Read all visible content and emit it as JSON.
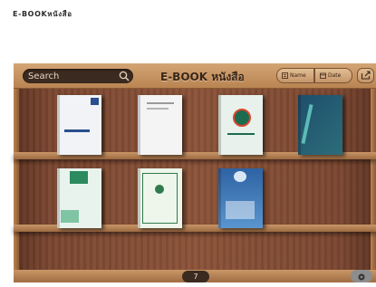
{
  "page": {
    "heading": "E-BOOKหนังสือ"
  },
  "toolbar": {
    "search_placeholder": "Search",
    "title": "E-BOOK หนังสือ",
    "sort_name_label": "Name",
    "sort_date_label": "Date"
  },
  "shelves": [
    {
      "books": [
        {
          "cover_color": "#f1f3f6",
          "accent_color": "#2a4f8f"
        },
        {
          "cover_color": "#f4f4f4",
          "accent_color": "#9a9a9a"
        },
        {
          "cover_color": "#e8f1ec",
          "accent_color": "#1c6b4f"
        },
        {
          "cover_color": "#1e4e6c",
          "accent_color": "#5dbbb7"
        }
      ]
    },
    {
      "books": [
        {
          "cover_color": "#e8f3ee",
          "accent_color": "#2b8a5e"
        },
        {
          "cover_color": "#eef5ea",
          "accent_color": "#2f7a4d"
        },
        {
          "cover_color": "#3c79b8",
          "accent_color": "#d8e6f4"
        }
      ]
    }
  ],
  "pagination": {
    "current_page": "7"
  }
}
